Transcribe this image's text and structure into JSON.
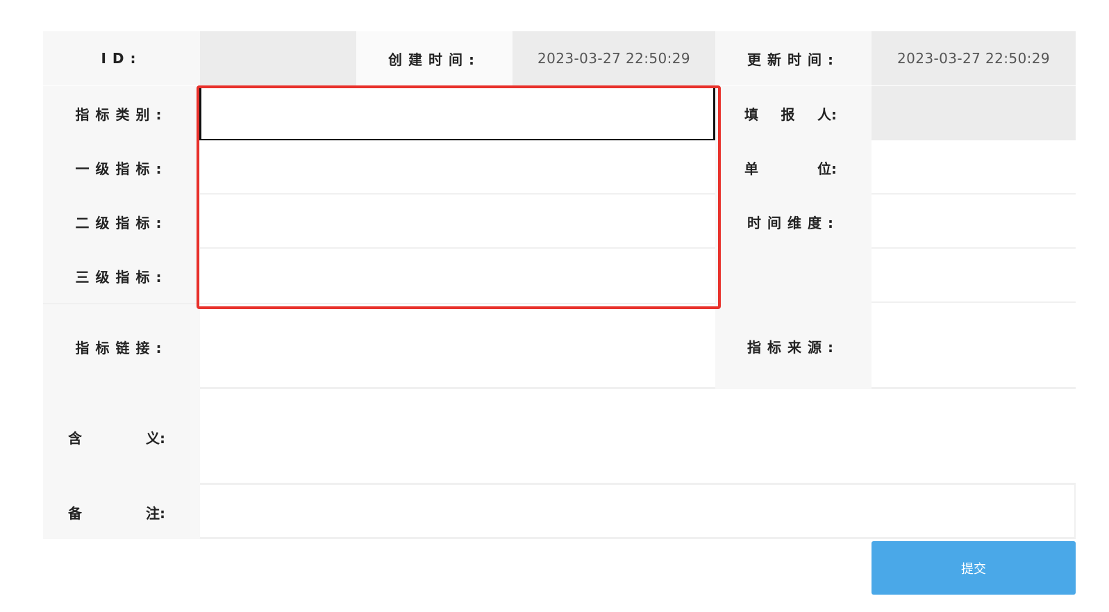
{
  "labels": {
    "id": "ID:",
    "created": "创建时间:",
    "updated": "更新时间:",
    "category": "指标类别:",
    "reporter_a": "填",
    "reporter_b": "报",
    "reporter_c": "人:",
    "level1": "一级指标:",
    "unit_a": "单",
    "unit_b": "位:",
    "level2": "二级指标:",
    "time_dim": "时间维度:",
    "level3": "三级指标:",
    "link": "指标链接:",
    "source": "指标来源:",
    "meaning_a": "含",
    "meaning_b": "义:",
    "remark_a": "备",
    "remark_b": "注:"
  },
  "values": {
    "id": "",
    "created_time": "2023-03-27 22:50:29",
    "updated_time": "2023-03-27 22:50:29",
    "category": "",
    "reporter": "",
    "level1": "",
    "unit": "",
    "level2": "",
    "time_dimension": "",
    "level3": "",
    "link": "",
    "source": "",
    "meaning": "",
    "remark": ""
  },
  "submit_label": "提交",
  "colors": {
    "highlight": "#e8312b",
    "submit": "#4aa8e8"
  }
}
